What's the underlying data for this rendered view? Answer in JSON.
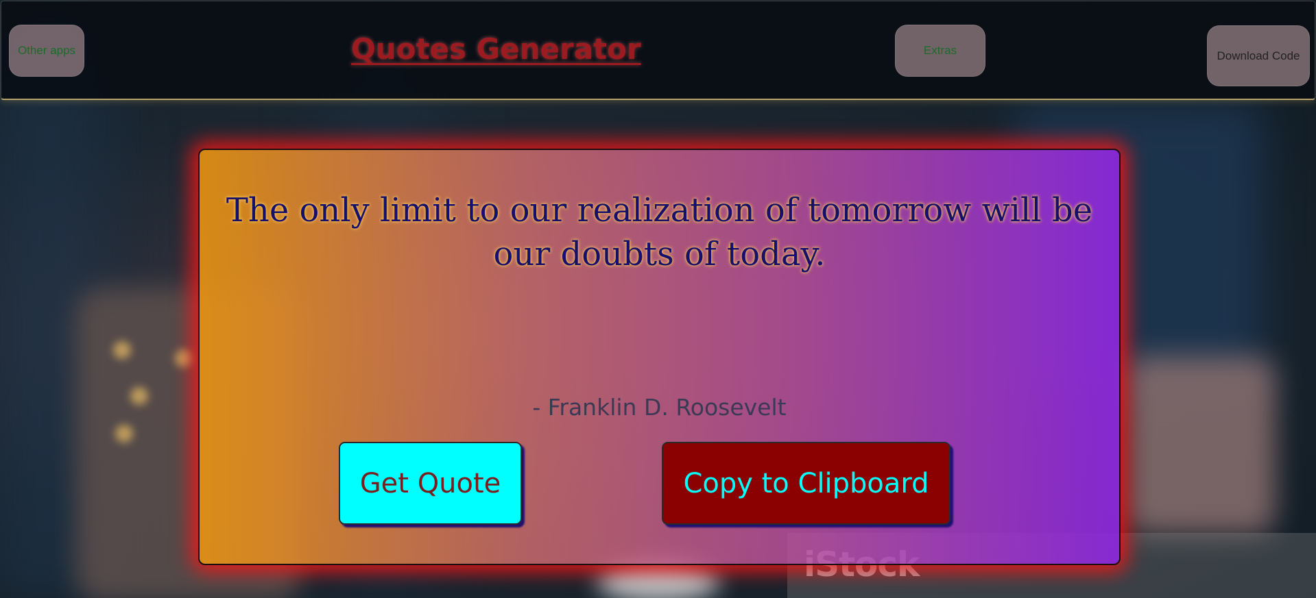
{
  "header": {
    "title": "Quotes Generator",
    "other_apps_label": "Other apps",
    "extras_label": "Extras",
    "download_label": "Download Code"
  },
  "quote": {
    "text": "The only limit to our realization of tomorrow will be our doubts of today.",
    "author": "- Franklin D. Roosevelt"
  },
  "actions": {
    "get_quote_label": "Get Quote",
    "copy_label": "Copy to Clipboard"
  },
  "background": {
    "watermark": "iStock"
  },
  "colors": {
    "title": "#9b1b20",
    "get_quote_bg": "#00ffff",
    "copy_bg": "#8b0000",
    "card_glow": "#ff1414",
    "card_gradient_start": "#e89412",
    "card_gradient_end": "#8c28dc"
  }
}
